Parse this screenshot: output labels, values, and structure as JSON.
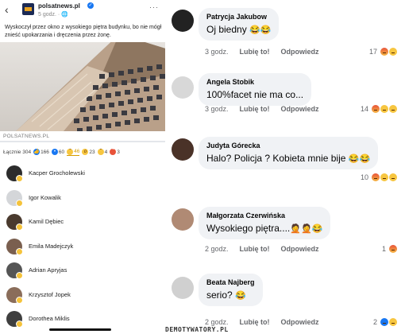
{
  "post": {
    "back_glyph": "‹",
    "page_name": "polsatnews.pl",
    "verified_glyph": "✓",
    "time": "5 godz. · 🌐",
    "more_glyph": "···",
    "text": "Wyskoczył przez okno z wysokiego piętra budynku, bo nie mógł znieść upokarzania i dręczenia przez żonę.",
    "link_domain": "POLSATNEWS.PL"
  },
  "reactions": {
    "total": "Łącznie 304",
    "tabs": [
      {
        "icon": "like-icon",
        "count": "166",
        "color": "#1877f2"
      },
      {
        "icon": "love-icon",
        "count": "60",
        "color": "#1877f2"
      },
      {
        "icon": "haha-icon",
        "count": "46",
        "color": "#f7c640"
      },
      {
        "icon": "wow-icon",
        "count": "23",
        "color": "#f7c640"
      },
      {
        "icon": "sad-icon",
        "count": "4",
        "color": "#f7c640"
      },
      {
        "icon": "angry-icon",
        "count": "3",
        "color": "#e8533a"
      }
    ]
  },
  "people": [
    "Kacper Grocholewski",
    "Igor Kowalik",
    "Kamil Dębiec",
    "Emila Madejczyk",
    "Adrian Apryjas",
    "Krzysztof Jopek",
    "Dorothea Miklis"
  ],
  "comments": [
    {
      "author": "Patrycja Jakubow",
      "text": "Oj biedny",
      "emoji": "😂😂",
      "time": "3 godz.",
      "like": "Lubię to!",
      "reply": "Odpowiedz",
      "count": "17"
    },
    {
      "author": "Angela Stobik",
      "text": "100%facet nie ma co...",
      "emoji": "",
      "time": "3 godz.",
      "like": "Lubię to!",
      "reply": "Odpowiedz",
      "count": "14"
    },
    {
      "author": "Judyta Górecka",
      "text": "Halo? Policja ? Kobieta mnie bije",
      "emoji": "😂😂",
      "time": "3 godz.",
      "like": "Lubię to!",
      "reply": "Odpowiedz",
      "count": "10"
    },
    {
      "author": "Małgorzata Czerwińska",
      "text": "Wysokiego piętra....",
      "emoji": "🤦🤦😂",
      "time": "2 godz.",
      "like": "Lubię to!",
      "reply": "Odpowiedz",
      "count": "1"
    },
    {
      "author": "Beata Najberg",
      "text": "serio?",
      "emoji": "😂",
      "time": "2 godz.",
      "like": "Lubię to!",
      "reply": "Odpowiedz",
      "count": "2"
    }
  ],
  "watermark": "DEMOTYWATORY.PL"
}
